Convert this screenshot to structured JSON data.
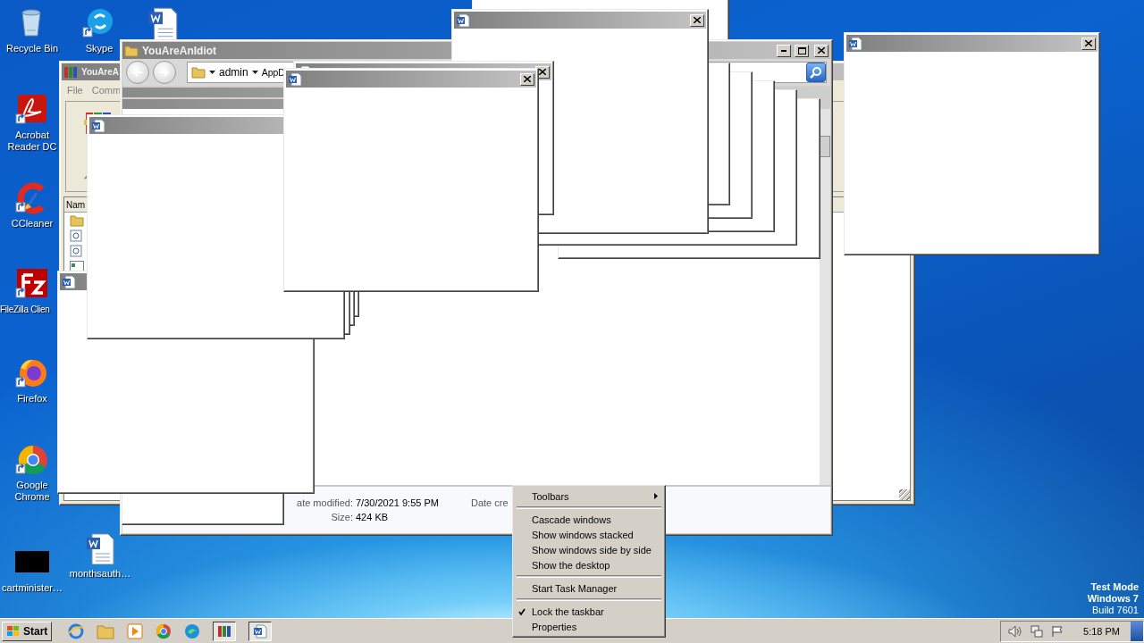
{
  "desktop_icons": [
    {
      "label": "Recycle Bin"
    },
    {
      "label": "Skype"
    },
    {
      "label": "Acrobat Reader DC"
    },
    {
      "label": "CCleaner"
    },
    {
      "label": "FileZilla Clien"
    },
    {
      "label": "Firefox"
    },
    {
      "label": "Google Chrome"
    },
    {
      "label": "cartminister…"
    },
    {
      "label": "monthsauth…"
    }
  ],
  "archive_window": {
    "title": "YouAreA",
    "menu": [
      "File",
      "Comm"
    ],
    "column": "Nam"
  },
  "explorer_window": {
    "title": "YouAreAnIdiot",
    "path": [
      "admin",
      "AppD"
    ],
    "details": [
      {
        "label": "ate modified:",
        "value": "7/30/2021 9:55 PM"
      },
      {
        "label": "Size:",
        "value": "424 KB"
      }
    ],
    "column_2_label": "Date cre"
  },
  "context_menu": [
    {
      "kind": "submenu",
      "label": "Toolbars",
      "checked": false
    },
    {
      "kind": "separator"
    },
    {
      "kind": "item",
      "label": "Cascade windows",
      "checked": false
    },
    {
      "kind": "item",
      "label": "Show windows stacked",
      "checked": false
    },
    {
      "kind": "item",
      "label": "Show windows side by side",
      "checked": false
    },
    {
      "kind": "item",
      "label": "Show the desktop",
      "checked": false
    },
    {
      "kind": "separator"
    },
    {
      "kind": "item",
      "label": "Start Task Manager",
      "checked": false
    },
    {
      "kind": "separator"
    },
    {
      "kind": "item",
      "label": "Lock the taskbar",
      "checked": true
    },
    {
      "kind": "item",
      "label": "Properties",
      "checked": false
    }
  ],
  "taskbar": {
    "start": "Start",
    "clock": "5:18 PM"
  },
  "test_mode": [
    "Test Mode",
    "Windows 7",
    "Build 7601"
  ]
}
